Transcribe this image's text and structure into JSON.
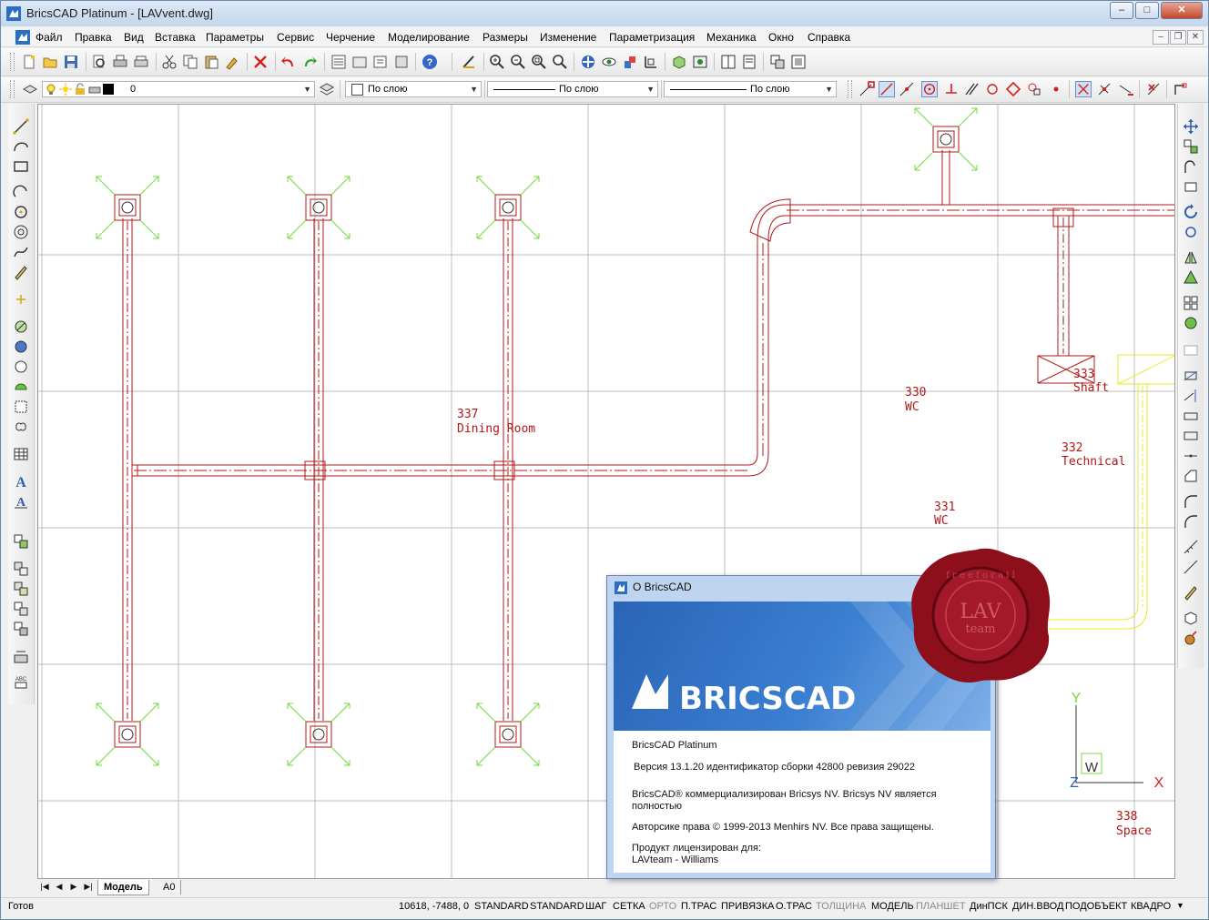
{
  "window": {
    "title": "BricsCAD Platinum - [LAVvent.dwg]",
    "min_label": "–",
    "max_label": "□",
    "close_label": "✕"
  },
  "menu": {
    "items": [
      "Файл",
      "Правка",
      "Вид",
      "Вставка",
      "Параметры",
      "Сервис",
      "Черчение",
      "Моделирование",
      "Размеры",
      "Изменение",
      "Параметризация",
      "Механика",
      "Окно",
      "Справка"
    ]
  },
  "properties_bar": {
    "layer_value": "0",
    "color_value": "По слою",
    "linetype_value": "По слою",
    "lineweight_value": "По слою"
  },
  "drawing": {
    "rooms": [
      {
        "number": "337",
        "name": "Dining Room"
      },
      {
        "number": "330",
        "name": "WC"
      },
      {
        "number": "333",
        "name": "Shaft"
      },
      {
        "number": "332",
        "name": "Technical"
      },
      {
        "number": "331",
        "name": "WC"
      },
      {
        "number": "338",
        "name": "Space"
      }
    ],
    "ucs": {
      "x_label": "X",
      "y_label": "Y",
      "z_label": "Z",
      "w_label": "W"
    },
    "colors": {
      "duct": "#b01818",
      "grip": "#6fdc3c",
      "yellow_duct": "#e8e82a",
      "grid": "#bdbdbd"
    }
  },
  "layout_tabs": {
    "active": "Модель",
    "other": "A0"
  },
  "status": {
    "ready": "Готов",
    "coords": "10618, -7488, 0",
    "items": [
      {
        "label": "STANDARD",
        "on": true
      },
      {
        "label": "STANDARD",
        "on": true
      },
      {
        "label": "ШАГ",
        "on": true
      },
      {
        "label": "СЕТКА",
        "on": true
      },
      {
        "label": "ОРТО",
        "on": false
      },
      {
        "label": "П.ТРАС",
        "on": true
      },
      {
        "label": "ПРИВЯЗКА",
        "on": true
      },
      {
        "label": "О.ТРАС",
        "on": true
      },
      {
        "label": "ТОЛЩИНА",
        "on": false
      },
      {
        "label": "МОДЕЛЬ",
        "on": true
      },
      {
        "label": "ПЛАНШЕТ",
        "on": false
      },
      {
        "label": "ДинПСК",
        "on": true
      },
      {
        "label": "ДИН.ВВОД",
        "on": true
      },
      {
        "label": "ПОДОБЪЕКТ",
        "on": true
      },
      {
        "label": "КВАДРО",
        "on": true
      }
    ]
  },
  "about_dialog": {
    "title": "О BricsCAD",
    "brand": "BRICSCAD",
    "product": "BricsCAD Platinum",
    "version": "Версия 13.1.20 идентификатор сборки 42800 ревизия 29022",
    "commercial_line1": "BricsCAD® коммерциализирован Bricsys NV. Bricsys NV является",
    "commercial_line2": "полностью",
    "copyright": "Авторсике права © 1999-2013 Menhirs NV. Все права защищены.",
    "licensed_to_label": "Продукт лицензирован для:",
    "licensee": "LAVteam - Williams"
  },
  "seal": {
    "main": "LAV",
    "sub": "team",
    "ring": "f r e e   f o r   a l l"
  }
}
